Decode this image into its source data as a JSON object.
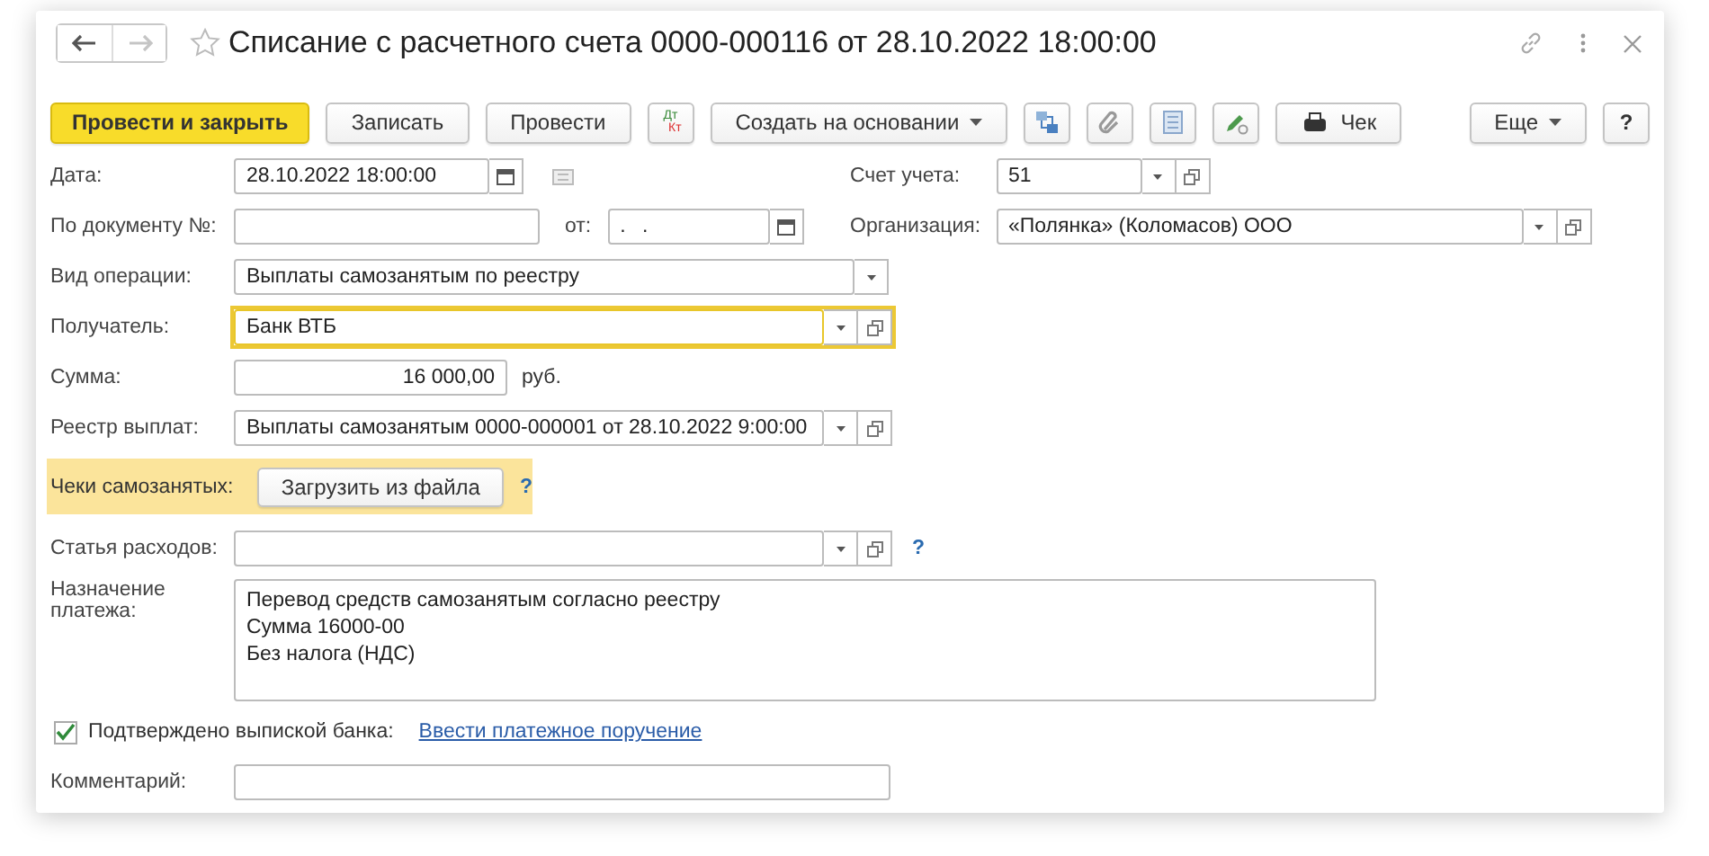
{
  "window": {
    "title": "Списание с расчетного счета 0000-000116 от 28.10.2022 18:00:00"
  },
  "nav": [
    {
      "kind": "back",
      "disabled": false
    },
    {
      "kind": "forward",
      "disabled": true
    }
  ],
  "toolbar": [
    {
      "kind": "primary",
      "label": "Провести и закрыть"
    },
    {
      "kind": "button",
      "label": "Записать"
    },
    {
      "kind": "button",
      "label": "Провести"
    },
    {
      "kind": "dtkt",
      "top": "Дт",
      "bottom": "Кт"
    },
    {
      "kind": "menu",
      "label": "Создать на основании"
    },
    {
      "kind": "structure"
    },
    {
      "kind": "attach"
    },
    {
      "kind": "list"
    },
    {
      "kind": "edit"
    },
    {
      "kind": "receipt",
      "label": "Чек"
    }
  ],
  "toolbar_right": [
    {
      "kind": "menu",
      "label": "Еще"
    },
    {
      "kind": "button",
      "label": "?"
    }
  ],
  "header": {
    "date": {
      "label": "Дата:",
      "value": "28.10.2022 18:00:00"
    },
    "doc_number": {
      "label": "По документу №:"
    },
    "doc_date": {
      "label": "от:",
      "value": ". ."
    },
    "account": {
      "label": "Счет учета:",
      "value": "51"
    },
    "organization": {
      "label": "Организация:",
      "value": "«Полянка» (Коломасов) ООО"
    }
  },
  "rows": [
    {
      "kind": "select",
      "label": "Вид операции:",
      "value": "Выплаты самозанятым по реестру",
      "focused": false
    },
    {
      "kind": "reference",
      "label": "Получатель:",
      "value": "Банк ВТБ",
      "focused": true
    },
    {
      "kind": "amount",
      "label": "Сумма:",
      "value": "16 000,00",
      "unit": "руб.",
      "focused": false
    },
    {
      "kind": "reference",
      "label": "Реестр выплат:",
      "value": "Выплаты самозанятым 0000-000001 от 28.10.2022 9:00:00",
      "focused": false
    },
    {
      "kind": "receipts",
      "label": "Чеки самозанятых:",
      "button": "Загрузить из файла",
      "help": "?"
    },
    {
      "kind": "reference",
      "label": "Статья расходов:",
      "help": "?",
      "focused": false
    },
    {
      "kind": "textarea",
      "label": "Назначение платежа:",
      "lines": [
        "Перевод средств самозанятым согласно реестру",
        "Сумма 16000-00",
        "Без налога (НДС)"
      ],
      "focused": false
    },
    {
      "kind": "checkbox",
      "label": "Подтверждено выпиской банка:",
      "checked": true,
      "link": "Ввести платежное поручение"
    },
    {
      "kind": "text",
      "label": "Комментарий:",
      "focused": false
    }
  ]
}
